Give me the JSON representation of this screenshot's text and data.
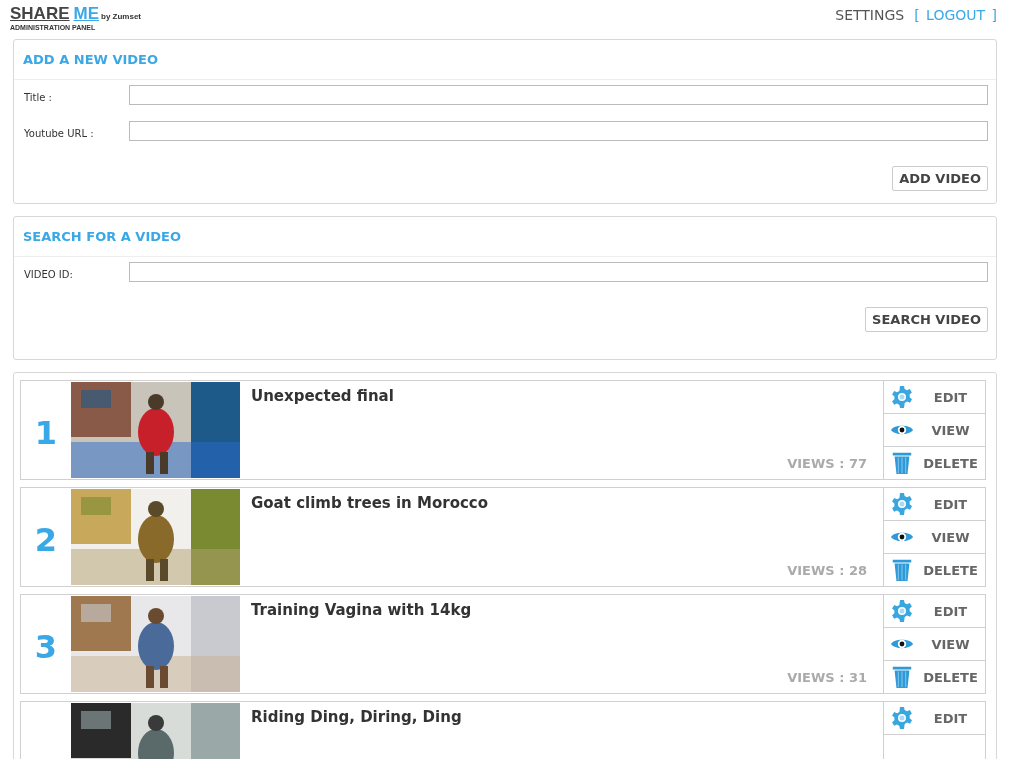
{
  "logo": {
    "title_dark": "SHARE",
    "title_light": "ME",
    "byline": "by Zumset",
    "subtitle": "ADMINISTRATION PANEL"
  },
  "nav": {
    "settings": "SETTINGS",
    "logout": "[ LOGOUT ]"
  },
  "add_panel": {
    "heading": "ADD A NEW VIDEO",
    "fields": [
      {
        "label": "Title :"
      },
      {
        "label": "Youtube URL :"
      }
    ],
    "button": "ADD VIDEO"
  },
  "search_panel": {
    "heading": "SEARCH FOR A VIDEO",
    "fields": [
      {
        "label": "VIDEO ID:"
      }
    ],
    "button": "SEARCH VIDEO"
  },
  "videos": [
    {
      "number": "1",
      "title": "Unexpected final",
      "views": "VIEWS : 77",
      "thumbnail": {
        "kind": "picture"
      },
      "actions": [
        "EDIT",
        "VIEW",
        "DELETE"
      ]
    },
    {
      "number": "2",
      "title": "Goat climb trees in Morocco",
      "views": "VIEWS : 28",
      "thumbnail": {
        "kind": "picture"
      },
      "actions": [
        "EDIT",
        "VIEW",
        "DELETE"
      ]
    },
    {
      "number": "3",
      "title": "Training Vagina with 14kg",
      "views": "VIEWS : 31",
      "thumbnail": {
        "kind": "picture"
      },
      "actions": [
        "EDIT",
        "VIEW",
        "DELETE"
      ]
    },
    {
      "title": "Riding Ding, Diring, Ding",
      "thumbnail": {
        "kind": "picture"
      },
      "actions": [
        "EDIT"
      ]
    }
  ]
}
